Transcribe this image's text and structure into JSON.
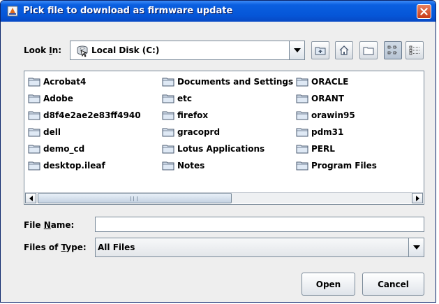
{
  "window": {
    "title": "Pick file to download as firmware update"
  },
  "lookin": {
    "label_prefix": "Look ",
    "label_mnemonic": "I",
    "label_suffix": "n:",
    "value": "Local Disk (C:)"
  },
  "files": [
    {
      "name": "Acrobat4"
    },
    {
      "name": "Adobe"
    },
    {
      "name": "d8f4e2ae2e83ff4940"
    },
    {
      "name": "dell"
    },
    {
      "name": "demo_cd"
    },
    {
      "name": "desktop.ileaf"
    },
    {
      "name": "Documents and Settings"
    },
    {
      "name": "etc"
    },
    {
      "name": "firefox"
    },
    {
      "name": "gracoprd"
    },
    {
      "name": "Lotus Applications"
    },
    {
      "name": "Notes"
    },
    {
      "name": "ORACLE"
    },
    {
      "name": "ORANT"
    },
    {
      "name": "orawin95"
    },
    {
      "name": "pdm31"
    },
    {
      "name": "PERL"
    },
    {
      "name": "Program Files"
    }
  ],
  "filename": {
    "label_prefix": "File ",
    "label_mnemonic": "N",
    "label_suffix": "ame:",
    "value": ""
  },
  "filetype": {
    "label_prefix": "Files of ",
    "label_mnemonic": "T",
    "label_suffix": "ype:",
    "value": "All Files"
  },
  "buttons": {
    "open": "Open",
    "cancel": "Cancel"
  },
  "icons": {
    "title": "java-app-icon",
    "close": "close-icon",
    "disk": "hard-disk-icon",
    "folder": "folder-icon",
    "up_folder": "up-one-level-icon",
    "home": "home-icon",
    "new_folder": "new-folder-icon",
    "list_view": "list-view-icon",
    "details_view": "details-view-icon"
  },
  "colors": {
    "titlebar": "#0556d8",
    "close_button": "#c83a17",
    "folder_fill": "#dfe9f5",
    "folder_stroke": "#4a5a70"
  }
}
